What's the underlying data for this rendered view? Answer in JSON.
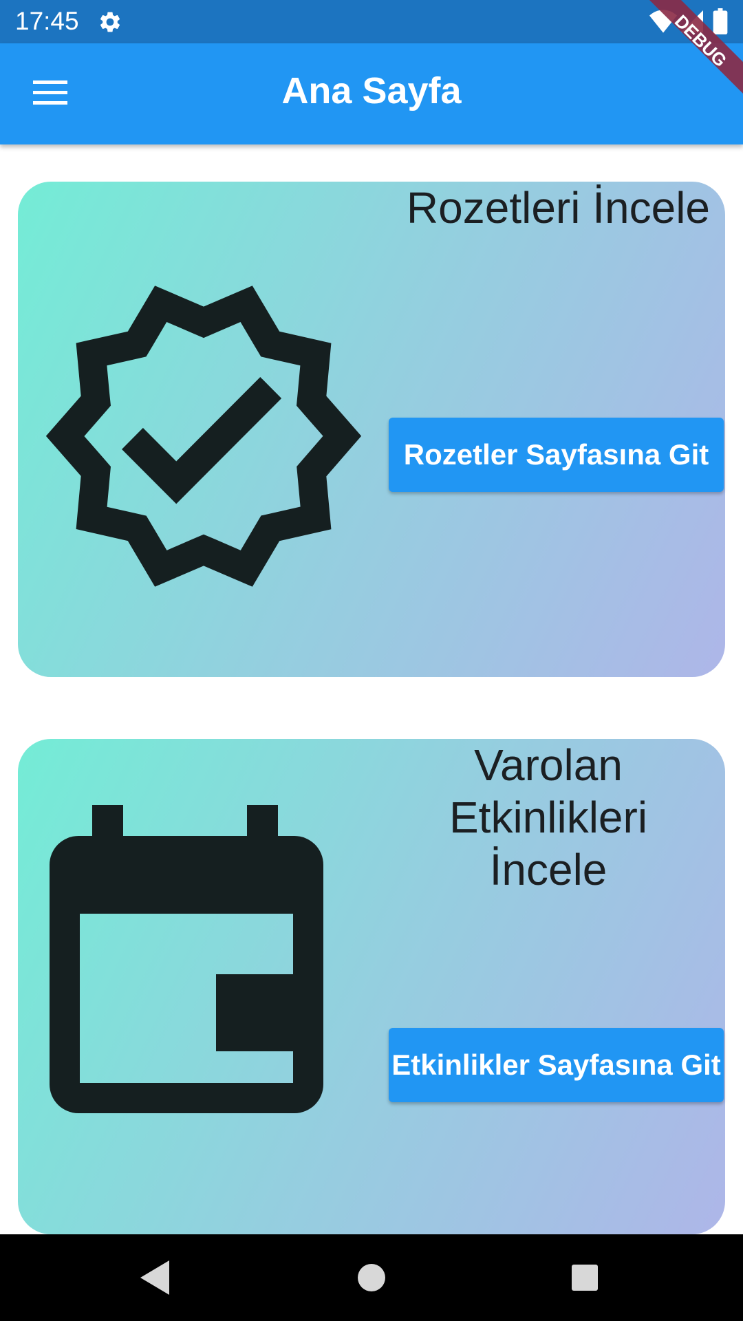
{
  "status_bar": {
    "time": "17:45",
    "icons": [
      "gear-icon",
      "wifi-icon",
      "signal-icon",
      "battery-icon"
    ]
  },
  "app_bar": {
    "title": "Ana Sayfa",
    "menu_icon": "menu-icon",
    "color": "#2196f3"
  },
  "debug_banner": {
    "label": "DEBUG",
    "color": "#8b2a45"
  },
  "cards": [
    {
      "title": "Rozetleri İncele",
      "icon": "verified-badge-icon",
      "button_label": "Rozetler Sayfasına Git"
    },
    {
      "title": "Varolan Etkinlikleri İncele",
      "icon": "calendar-icon",
      "button_label": "Etkinlikler Sayfasına Git"
    }
  ],
  "nav_bar": {
    "buttons": [
      "back-icon",
      "home-icon",
      "recents-icon"
    ]
  },
  "colors": {
    "status_bar": "#1c74c0",
    "gradient_start": "#74ecd6",
    "gradient_end": "#aeb6e8",
    "icon_dark": "#151f20",
    "button": "#2196f3"
  }
}
